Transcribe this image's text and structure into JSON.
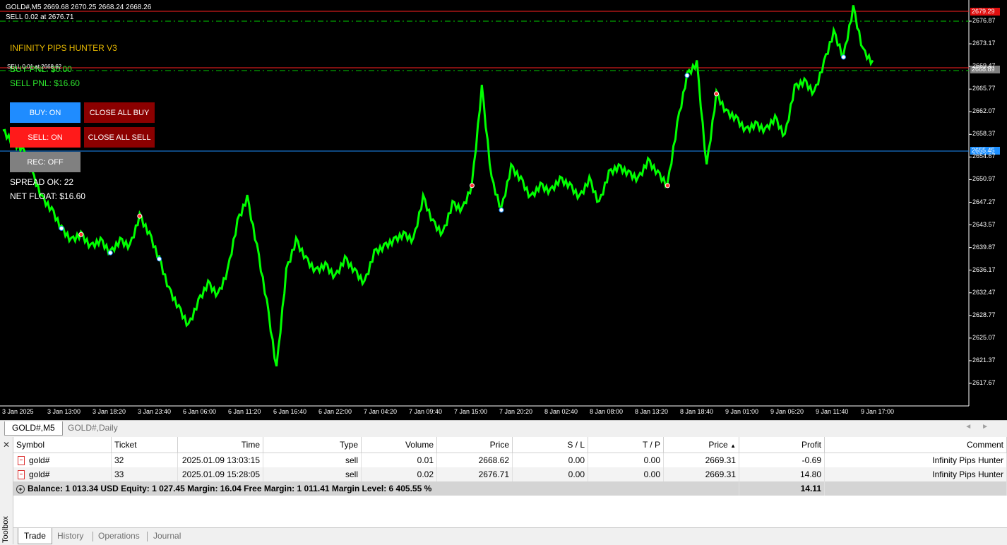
{
  "chart": {
    "title": "GOLD#,M5  2669.68 2670.25 2668.24 2668.26",
    "subtitle": "SELL 0.02 at 2676.71",
    "overlay_label": "SELL 0.01 at 2668.62",
    "ea_title": "INFINITY PIPS HUNTER V3",
    "buy_pnl": "BUY PNL: $0.00",
    "sell_pnl": "SELL PNL: $16.60",
    "spread": "SPREAD OK: 22",
    "net_float": "NET FLOAT: $16.60",
    "badges": {
      "top": "2679.29",
      "mid": "2668.89",
      "blue": "2655.45"
    },
    "colors": {
      "background": "#000000",
      "candles": "#00ff00",
      "buy_line": "#1e90ff",
      "sell_line": "#ff2020"
    }
  },
  "buttons": {
    "buy": "BUY: ON",
    "close_buy": "CLOSE ALL BUY",
    "sell": "SELL: ON",
    "close_sell": "CLOSE ALL SELL",
    "rec": "REC: OFF"
  },
  "chart_data": {
    "type": "line",
    "ylim": [
      2614.5,
      2680.5
    ],
    "y_ticks": [
      "2676.87",
      "2673.17",
      "2669.47",
      "2665.77",
      "2662.07",
      "2658.37",
      "2654.67",
      "2650.97",
      "2647.27",
      "2643.57",
      "2639.87",
      "2636.17",
      "2632.47",
      "2628.77",
      "2625.07",
      "2621.37",
      "2617.67"
    ],
    "x_ticks": [
      "3 Jan 2025",
      "3 Jan 13:00",
      "3 Jan 18:20",
      "3 Jan 23:40",
      "6 Jan 06:00",
      "6 Jan 11:20",
      "6 Jan 16:40",
      "6 Jan 22:00",
      "7 Jan 04:20",
      "7 Jan 09:40",
      "7 Jan 15:00",
      "7 Jan 20:20",
      "8 Jan 02:40",
      "8 Jan 08:00",
      "8 Jan 13:20",
      "8 Jan 18:40",
      "9 Jan 01:00",
      "9 Jan 06:20",
      "9 Jan 11:40",
      "9 Jan 17:00"
    ],
    "series": [
      {
        "values": [
          2659,
          2657,
          2656,
          2652,
          2648,
          2646,
          2643,
          2641,
          2642,
          2640,
          2641,
          2639,
          2641,
          2640,
          2645,
          2642,
          2638,
          2633,
          2630,
          2627,
          2631,
          2634,
          2632,
          2636,
          2644,
          2648,
          2640,
          2631,
          2620,
          2636,
          2641,
          2638,
          2636,
          2637,
          2635,
          2638,
          2636,
          2634,
          2639,
          2640,
          2641,
          2642,
          2641,
          2648,
          2644,
          2642,
          2647,
          2646,
          2650,
          2666,
          2651,
          2646,
          2653,
          2651,
          2648,
          2650,
          2649,
          2651,
          2650,
          2648,
          2651,
          2647,
          2652,
          2653,
          2652,
          2651,
          2654,
          2652,
          2650,
          2660,
          2668,
          2670,
          2653,
          2665,
          2662,
          2661,
          2659,
          2660,
          2659,
          2661,
          2658,
          2666,
          2667,
          2665,
          2670,
          2675,
          2671,
          2679,
          2672,
          2670
        ]
      }
    ]
  },
  "chart_tabs": [
    "GOLD#,M5",
    "GOLD#,Daily"
  ],
  "toolbox": {
    "side_label": "Toolbox",
    "columns": [
      "Symbol",
      "Ticket",
      "Time",
      "Type",
      "Volume",
      "Price",
      "S / L",
      "T / P",
      "Price",
      "Profit",
      "Comment"
    ],
    "rows": [
      [
        "gold#",
        "32",
        "2025.01.09 13:03:15",
        "sell",
        "0.01",
        "2668.62",
        "0.00",
        "0.00",
        "2669.31",
        "-0.69",
        "Infinity Pips Hunter"
      ],
      [
        "gold#",
        "33",
        "2025.01.09 15:28:05",
        "sell",
        "0.02",
        "2676.71",
        "0.00",
        "0.00",
        "2669.31",
        "14.80",
        "Infinity Pips Hunter"
      ]
    ],
    "summary": "Balance: 1 013.34 USD  Equity: 1 027.45  Margin: 16.04  Free Margin: 1 011.41  Margin Level: 6 405.55 %",
    "summary_profit": "14.11",
    "tabs": [
      "Trade",
      "History",
      "Operations",
      "Journal"
    ]
  }
}
